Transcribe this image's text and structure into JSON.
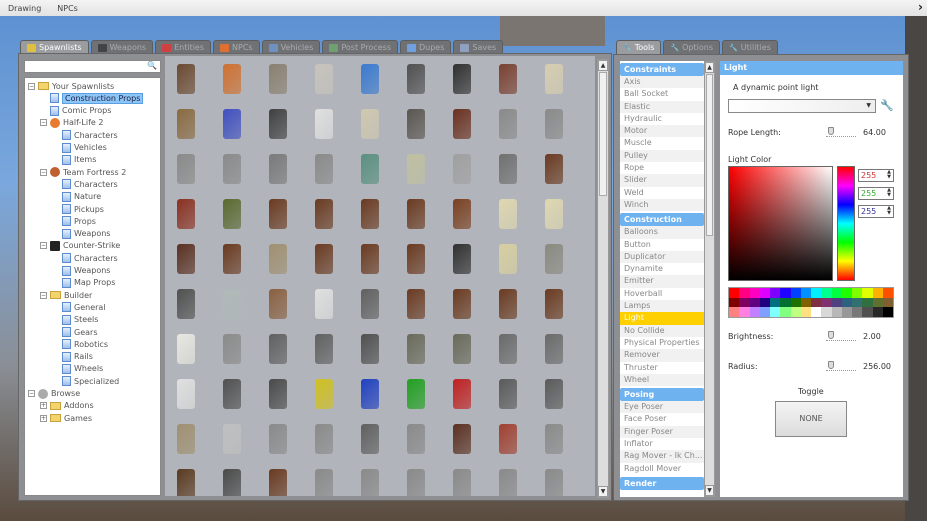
{
  "topbar": {
    "items": [
      "Drawing",
      "NPCs"
    ],
    "right_icon": "chevron-right-icon"
  },
  "spawnmenu": {
    "tabs": [
      {
        "label": "Spawnlists",
        "icon": "spawnlist-icon",
        "color": "#e0c040",
        "active": true
      },
      {
        "label": "Weapons",
        "icon": "gun-icon",
        "color": "#444444"
      },
      {
        "label": "Entities",
        "icon": "entities-icon",
        "color": "#d04040"
      },
      {
        "label": "NPCs",
        "icon": "npc-icon",
        "color": "#e07030"
      },
      {
        "label": "Vehicles",
        "icon": "car-icon",
        "color": "#7090c0"
      },
      {
        "label": "Post Process",
        "icon": "image-icon",
        "color": "#70a070"
      },
      {
        "label": "Dupes",
        "icon": "dupe-icon",
        "color": "#70a0e0"
      },
      {
        "label": "Saves",
        "icon": "save-icon",
        "color": "#90a0c0"
      }
    ],
    "search": {
      "value": "",
      "icon": "search-icon"
    },
    "tree": [
      {
        "label": "Your Spawnlists",
        "level": 0,
        "type": "folder",
        "expander": "−"
      },
      {
        "label": "Construction Props",
        "level": 1,
        "type": "doc",
        "selected": true
      },
      {
        "label": "Comic Props",
        "level": 1,
        "type": "doc"
      },
      {
        "label": "Half-Life 2",
        "level": 1,
        "type": "hl2",
        "expander": "−"
      },
      {
        "label": "Characters",
        "level": 2,
        "type": "doc"
      },
      {
        "label": "Vehicles",
        "level": 2,
        "type": "doc"
      },
      {
        "label": "Items",
        "level": 2,
        "type": "doc"
      },
      {
        "label": "Team Fortress 2",
        "level": 1,
        "type": "tf2",
        "expander": "−"
      },
      {
        "label": "Characters",
        "level": 2,
        "type": "doc"
      },
      {
        "label": "Nature",
        "level": 2,
        "type": "doc"
      },
      {
        "label": "Pickups",
        "level": 2,
        "type": "doc"
      },
      {
        "label": "Props",
        "level": 2,
        "type": "doc"
      },
      {
        "label": "Weapons",
        "level": 2,
        "type": "doc"
      },
      {
        "label": "Counter-Strike",
        "level": 1,
        "type": "cs",
        "expander": "−"
      },
      {
        "label": "Characters",
        "level": 2,
        "type": "doc"
      },
      {
        "label": "Weapons",
        "level": 2,
        "type": "doc"
      },
      {
        "label": "Map Props",
        "level": 2,
        "type": "doc"
      },
      {
        "label": "Builder",
        "level": 1,
        "type": "folder",
        "expander": "−"
      },
      {
        "label": "General",
        "level": 2,
        "type": "doc"
      },
      {
        "label": "Steels",
        "level": 2,
        "type": "doc"
      },
      {
        "label": "Gears",
        "level": 2,
        "type": "doc"
      },
      {
        "label": "Robotics",
        "level": 2,
        "type": "doc"
      },
      {
        "label": "Rails",
        "level": 2,
        "type": "doc"
      },
      {
        "label": "Wheels",
        "level": 2,
        "type": "doc"
      },
      {
        "label": "Specialized",
        "level": 2,
        "type": "doc"
      },
      {
        "label": "Browse",
        "level": 0,
        "type": "browse",
        "expander": "−"
      },
      {
        "label": "Addons",
        "level": 1,
        "type": "folder",
        "expander": "+"
      },
      {
        "label": "Games",
        "level": 1,
        "type": "folder",
        "expander": "+"
      }
    ]
  },
  "toolmenu": {
    "tabs": [
      {
        "label": "Tools",
        "icon": "wrench-icon",
        "active": true
      },
      {
        "label": "Options",
        "icon": "wrench-icon"
      },
      {
        "label": "Utilities",
        "icon": "utilities-icon"
      }
    ],
    "categories": [
      {
        "label": "Constraints",
        "items": [
          "Axis",
          "Ball Socket",
          "Elastic",
          "Hydraulic",
          "Motor",
          "Muscle",
          "Pulley",
          "Rope",
          "Slider",
          "Weld",
          "Winch"
        ]
      },
      {
        "label": "Construction",
        "items": [
          "Balloons",
          "Button",
          "Duplicator",
          "Dynamite",
          "Emitter",
          "Hoverball",
          "Lamps",
          "Light",
          "No Collide",
          "Physical Properties",
          "Remover",
          "Thruster",
          "Wheel"
        ]
      },
      {
        "label": "Posing",
        "items": [
          "Eye Poser",
          "Face Poser",
          "Finger Poser",
          "Inflator",
          "Rag Mover - Ik Ch...",
          "Ragdoll Mover"
        ]
      },
      {
        "label": "Render",
        "items": []
      }
    ],
    "selected_tool": "Light",
    "selected_color": "#ffd000"
  },
  "settings": {
    "title": "Light",
    "description": "A dynamic point light",
    "preset_value": "",
    "rope_length": {
      "label": "Rope Length:",
      "value": "64.00"
    },
    "light_color": {
      "label": "Light Color",
      "r": "255",
      "g": "255",
      "b": "255"
    },
    "palette": [
      "#ff0000",
      "#ff0080",
      "#ff00c0",
      "#e000ff",
      "#8000ff",
      "#2000ff",
      "#0040ff",
      "#0090ff",
      "#00f0ff",
      "#00ff90",
      "#00ff40",
      "#20ff00",
      "#80ff00",
      "#e0ff00",
      "#ffb000",
      "#ff5000",
      "#800000",
      "#800060",
      "#600080",
      "#200080",
      "#007080",
      "#007030",
      "#207000",
      "#806000",
      "#803040",
      "#803070",
      "#504080",
      "#306080",
      "#307070",
      "#307040",
      "#607030",
      "#806030",
      "#ff8080",
      "#ff80e0",
      "#c080ff",
      "#80a0ff",
      "#80ffff",
      "#80ff80",
      "#c0ff80",
      "#ffe080",
      "#ffffff",
      "#d8d8d8",
      "#b8b8b8",
      "#989898",
      "#787878",
      "#505050",
      "#282828",
      "#000000"
    ],
    "brightness": {
      "label": "Brightness:",
      "value": "2.00"
    },
    "radius": {
      "label": "Radius:",
      "value": "256.00"
    },
    "toggle": {
      "label": "Toggle",
      "value": "NONE"
    }
  }
}
